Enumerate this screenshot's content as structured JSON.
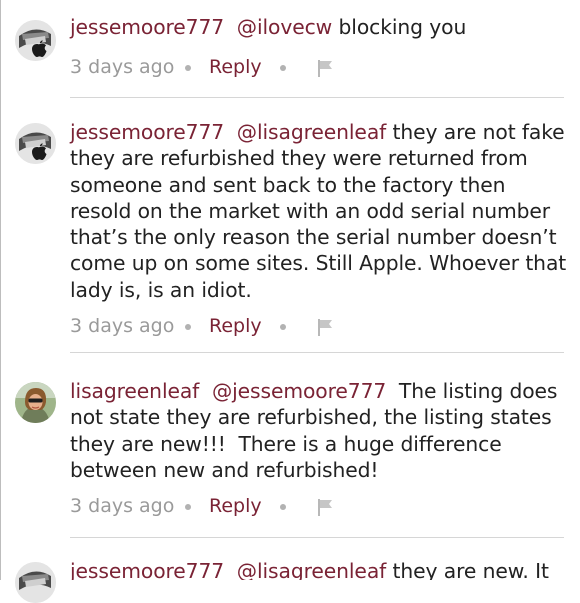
{
  "comments": [
    {
      "username": "jessemoore777",
      "mention": "@ilovecw",
      "text": "blocking you",
      "time": "3 days ago",
      "reply_label": "Reply",
      "avatar": "apple-logo-avatar"
    },
    {
      "username": "jessemoore777",
      "mention": "@lisagreenleaf",
      "text": "they are not fake they are refurbished they were returned from someone and sent back to the factory then resold on the market with an odd serial number that’s the only reason the serial number doesn’t come up on some sites. Still Apple. Whoever that lady is, is an idiot.",
      "time": "3 days ago",
      "reply_label": "Reply",
      "avatar": "apple-logo-avatar"
    },
    {
      "username": "lisagreenleaf",
      "mention": "@jessemoore777",
      "text": " The listing does not state they are refurbished, the listing states they are new!!!  There is a huge difference between new and refurbished!",
      "time": "3 days ago",
      "reply_label": "Reply",
      "avatar": "photo-avatar"
    },
    {
      "username": "jessemoore777",
      "mention": "@lisagreenleaf",
      "text": "they are new. It",
      "avatar": "apple-logo-avatar"
    }
  ],
  "icons": {
    "flag": "flag-icon",
    "separator": "dot-separator"
  },
  "colors": {
    "link": "#7a2335",
    "meta": "#9a9a9a",
    "divider": "#d6d6d6"
  }
}
